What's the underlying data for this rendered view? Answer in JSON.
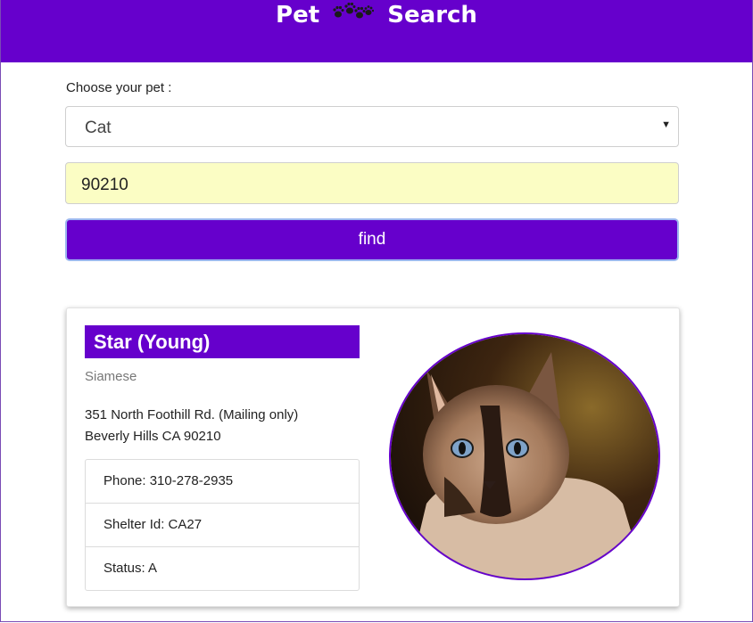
{
  "header": {
    "logo_left": "Pet",
    "logo_right": "Search",
    "logo_icon": "paw-prints-icon"
  },
  "form": {
    "label": "Choose your pet :",
    "pet_type_value": "Cat",
    "zip_value": "90210",
    "find_label": "find"
  },
  "result": {
    "name": "Star (Young)",
    "breed": "Siamese",
    "address_line1": "351 North Foothill Rd. (Mailing only)",
    "address_line2": "Beverly Hills CA 90210",
    "phone": "Phone: 310-278-2935",
    "shelter_id": "Shelter Id: CA27",
    "status": "Status: A"
  },
  "colors": {
    "brand": "#6600cc",
    "zip_bg": "#fbfdc4",
    "find_border": "#9db7f0"
  }
}
